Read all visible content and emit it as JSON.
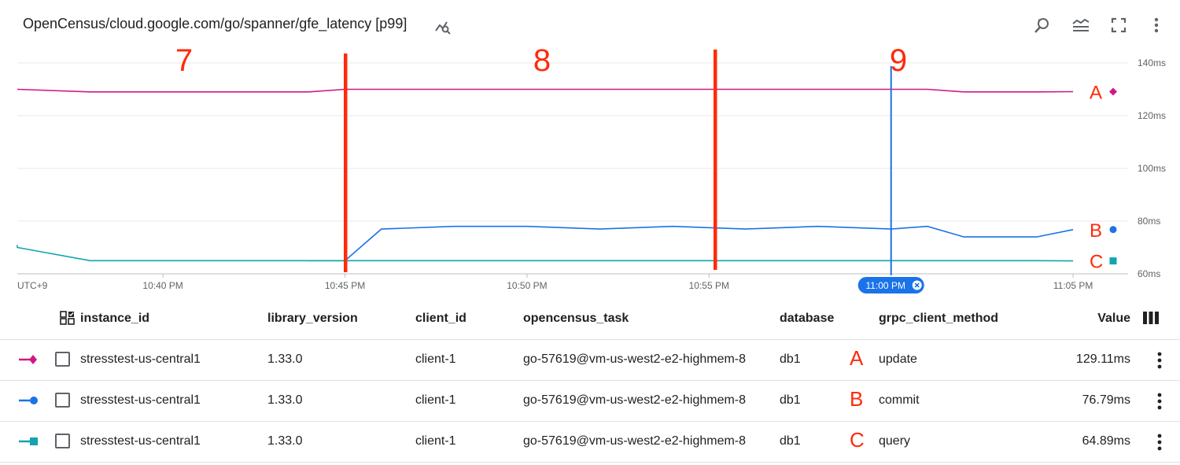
{
  "header": {
    "title": "OpenCensus/cloud.google.com/go/spanner/gfe_latency [p99]",
    "icons": [
      "chart-explore-icon",
      "reset-zoom-icon",
      "legend-toggle-icon",
      "fullscreen-icon",
      "more-vert-icon"
    ]
  },
  "annotations": {
    "section_labels": [
      "7",
      "8",
      "9"
    ],
    "series_letters": [
      "A",
      "B",
      "C"
    ],
    "color": "#ff2a0a"
  },
  "chart_data": {
    "type": "line",
    "x": [
      "10:36 PM",
      "10:38 PM",
      "10:40 PM",
      "10:42 PM",
      "10:44 PM",
      "10:45 PM",
      "10:46 PM",
      "10:48 PM",
      "10:50 PM",
      "10:52 PM",
      "10:54 PM",
      "10:56 PM",
      "10:58 PM",
      "11:00 PM",
      "11:01 PM",
      "11:02 PM",
      "11:04 PM",
      "11:05 PM"
    ],
    "series": [
      {
        "name": "update",
        "color": "#d01884",
        "marker": "diamond",
        "values": [
          130,
          129,
          129,
          129,
          129,
          130,
          130,
          130,
          130,
          130,
          130,
          130,
          130,
          130,
          130,
          129,
          129,
          129.11
        ]
      },
      {
        "name": "commit",
        "color": "#1a73e8",
        "marker": "circle",
        "values": [
          null,
          null,
          null,
          null,
          null,
          65,
          77,
          78,
          78,
          77,
          78,
          77,
          78,
          77,
          78,
          74,
          74,
          76.79
        ]
      },
      {
        "name": "query",
        "color": "#12a4af",
        "marker": "square",
        "values": [
          70,
          65,
          65,
          65,
          65,
          65,
          65,
          65,
          65,
          65,
          65,
          65,
          65,
          65,
          65,
          65,
          65,
          64.89
        ]
      }
    ],
    "timezone_label": "UTC+9",
    "x_ticks": [
      "10:40 PM",
      "10:45 PM",
      "10:50 PM",
      "10:55 PM",
      "11:05 PM"
    ],
    "selected_time": "11:00 PM",
    "y_ticks": [
      "140ms",
      "120ms",
      "100ms",
      "80ms",
      "60ms"
    ],
    "ylim": [
      60,
      140
    ],
    "grid": true
  },
  "table": {
    "headers": {
      "instance_id": "instance_id",
      "library_version": "library_version",
      "client_id": "client_id",
      "opencensus_task": "opencensus_task",
      "database": "database",
      "grpc_client_method": "grpc_client_method",
      "value": "Value"
    },
    "rows": [
      {
        "instance_id": "stresstest-us-central1",
        "library_version": "1.33.0",
        "client_id": "client-1",
        "opencensus_task": "go-57619@vm-us-west2-e2-highmem-8",
        "database": "db1",
        "grpc_client_method": "update",
        "value": "129.11ms",
        "color": "#d01884",
        "marker": "diamond"
      },
      {
        "instance_id": "stresstest-us-central1",
        "library_version": "1.33.0",
        "client_id": "client-1",
        "opencensus_task": "go-57619@vm-us-west2-e2-highmem-8",
        "database": "db1",
        "grpc_client_method": "commit",
        "value": "76.79ms",
        "color": "#1a73e8",
        "marker": "circle"
      },
      {
        "instance_id": "stresstest-us-central1",
        "library_version": "1.33.0",
        "client_id": "client-1",
        "opencensus_task": "go-57619@vm-us-west2-e2-highmem-8",
        "database": "db1",
        "grpc_client_method": "query",
        "value": "64.89ms",
        "color": "#12a4af",
        "marker": "square"
      }
    ]
  }
}
